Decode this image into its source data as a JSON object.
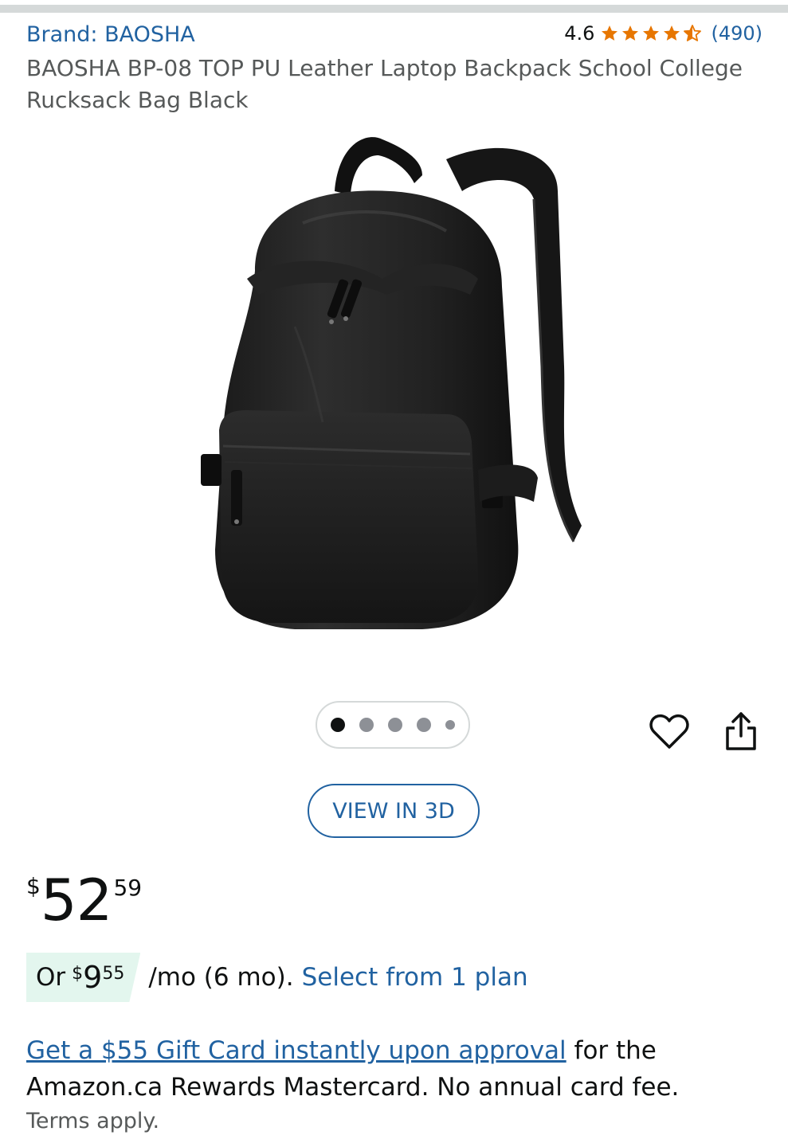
{
  "product": {
    "brand": "Brand: BAOSHA",
    "rating": "4.6",
    "rating_value": 4.6,
    "review_count": "(490)",
    "title": "BAOSHA BP-08 TOP PU Leather Laptop Backpack School College Rucksack Bag Black"
  },
  "gallery": {
    "total_images": 5,
    "active_index": 0,
    "view_3d_label": "VIEW IN 3D",
    "icons": [
      "heart-icon",
      "share-icon"
    ]
  },
  "pricing": {
    "currency": "$",
    "whole": "52",
    "fraction": "59",
    "monthly_prefix": "Or",
    "monthly_currency": "$",
    "monthly_whole": "9",
    "monthly_fraction": "55",
    "monthly_suffix": "/mo (6 mo).",
    "plan_link": "Select from 1 plan"
  },
  "promo": {
    "link_text": "Get a $55 Gift Card instantly upon approval",
    "rest_text": " for the Amazon.ca Rewards Mastercard. No annual card fee.",
    "terms": "Terms apply."
  },
  "colors": {
    "link": "#2162a1",
    "star": "#e77600",
    "monthly_highlight": "#e3f6ee"
  }
}
